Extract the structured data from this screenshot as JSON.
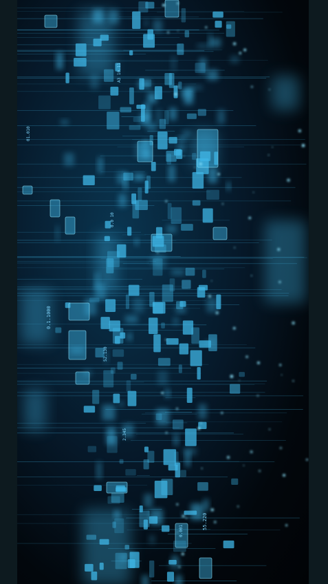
{
  "image": {
    "subject": "data-visualization",
    "accent_color": "#3fb6e6",
    "glow_color": "#8ee6ff",
    "background_color": "#03080d",
    "frame_color": "#0d1a1f"
  },
  "visible_labels": [
    "01.010",
    "A3 10.11",
    "0.1.1000",
    "0.0 10",
    "52.130",
    "2.345",
    "0.001",
    "55.220"
  ]
}
